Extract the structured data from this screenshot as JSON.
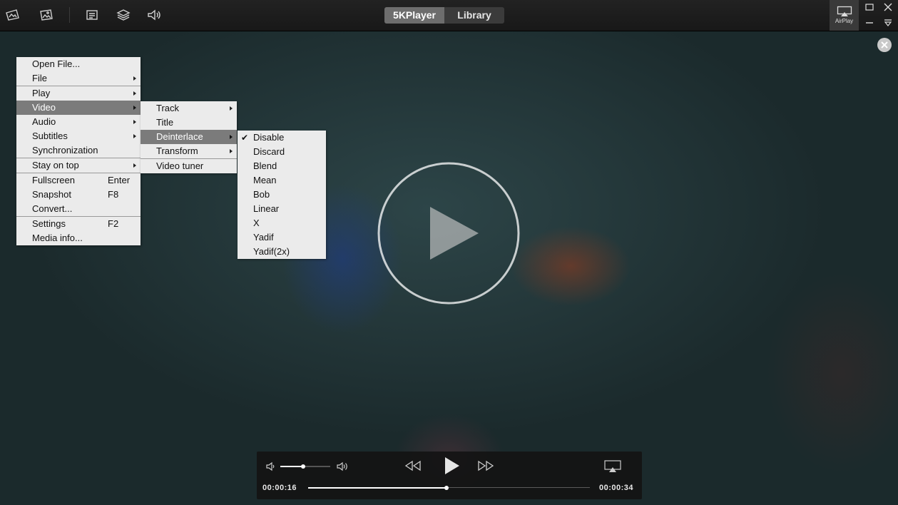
{
  "topbar": {
    "tabs": [
      {
        "label": "5KPlayer",
        "active": true
      },
      {
        "label": "Library",
        "active": false
      }
    ],
    "airplay_label": "AirPlay",
    "icons": [
      "video-open-icon",
      "photo-icon",
      "playlist-icon",
      "layers-icon",
      "audio-icon"
    ]
  },
  "menu": {
    "items": [
      {
        "label": "Open File...",
        "submenu": false
      },
      {
        "label": "File",
        "submenu": true
      },
      {
        "label": "Play",
        "submenu": true
      },
      {
        "label": "Video",
        "submenu": true,
        "active": true
      },
      {
        "label": "Audio",
        "submenu": true
      },
      {
        "label": "Subtitles",
        "submenu": true
      },
      {
        "label": "Synchronization",
        "submenu": false
      },
      {
        "label": "Stay on top",
        "submenu": true
      },
      {
        "label": "Fullscreen",
        "shortcut": "Enter"
      },
      {
        "label": "Snapshot",
        "shortcut": "F8"
      },
      {
        "label": "Convert..."
      },
      {
        "label": "Settings",
        "shortcut": "F2"
      },
      {
        "label": "Media info..."
      }
    ]
  },
  "video_submenu": {
    "items": [
      {
        "label": "Track",
        "submenu": true
      },
      {
        "label": "Title",
        "submenu": false
      },
      {
        "label": "Deinterlace",
        "submenu": true,
        "active": true
      },
      {
        "label": "Transform",
        "submenu": true
      },
      {
        "label": "Video tuner",
        "submenu": false
      }
    ]
  },
  "deinterlace_submenu": {
    "checked_glyph": "✔",
    "items": [
      {
        "label": "Disable",
        "checked": true
      },
      {
        "label": "Discard"
      },
      {
        "label": "Blend"
      },
      {
        "label": "Mean"
      },
      {
        "label": "Bob"
      },
      {
        "label": "Linear"
      },
      {
        "label": "X"
      },
      {
        "label": "Yadif"
      },
      {
        "label": "Yadif(2x)"
      }
    ]
  },
  "player": {
    "current_time": "00:00:16",
    "total_time": "00:00:34",
    "progress_fraction": 0.49,
    "volume_fraction": 0.45
  },
  "colors": {
    "menu_bg": "#ebebeb",
    "menu_active": "#7b7b7b",
    "accent": "#ffffff"
  }
}
